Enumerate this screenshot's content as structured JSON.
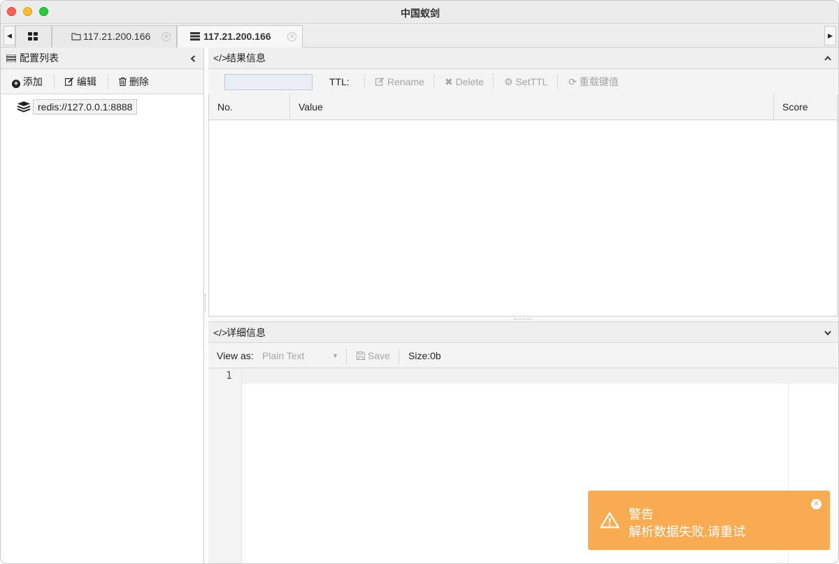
{
  "window": {
    "title": "中国蚁剑"
  },
  "tabs": [
    {
      "label": "117.21.200.166",
      "icon": "folder-icon"
    },
    {
      "label": "117.21.200.166",
      "icon": "server-icon",
      "active": true
    }
  ],
  "left": {
    "header": "配置列表",
    "toolbar": {
      "add": "添加",
      "edit": "编辑",
      "delete": "删除"
    },
    "tree": [
      {
        "label": "redis://127.0.0.1:8888",
        "icon": "database-icon"
      }
    ]
  },
  "result": {
    "header": "结果信息",
    "toolbar": {
      "ttl_label": "TTL:",
      "rename": "Rename",
      "delete": "Delete",
      "setttl": "SetTTL",
      "reload": "重载键值"
    },
    "columns": [
      "No.",
      "Value",
      "Score"
    ],
    "rows": []
  },
  "detail": {
    "header": "详细信息",
    "view_as_label": "View as:",
    "view_as_value": "Plain Text",
    "save": "Save",
    "size": "Size:0b",
    "line_numbers": [
      "1"
    ]
  },
  "toast": {
    "title": "警告",
    "message": "解析数据失败,请重试",
    "color": "#f8ab50"
  }
}
